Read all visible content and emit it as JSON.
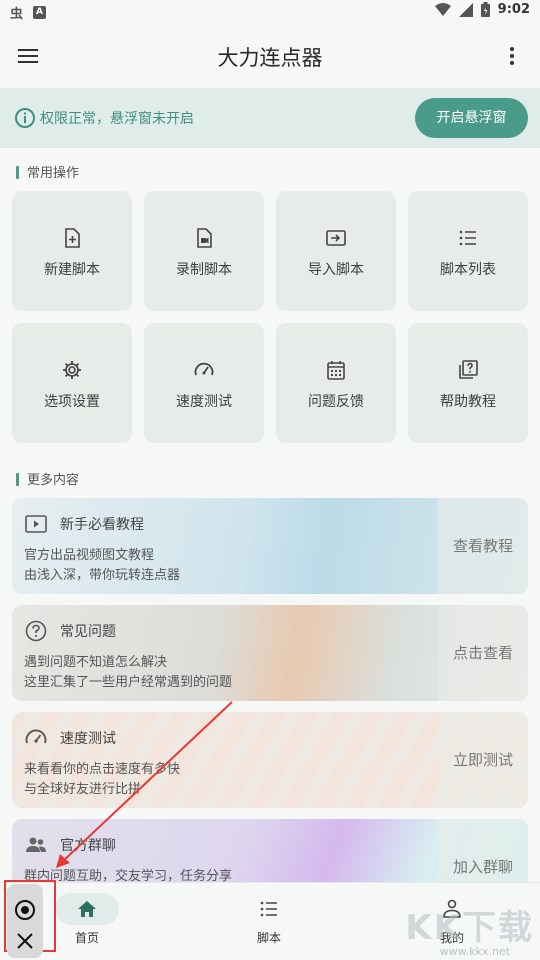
{
  "status_bar": {
    "left_glyph": "虫",
    "left_box": "A",
    "time": "9:02"
  },
  "app_bar": {
    "title": "大力连点器"
  },
  "banner": {
    "text": "权限正常，悬浮窗未开启",
    "button": "开启悬浮窗"
  },
  "common_ops": {
    "title": "常用操作",
    "tiles": [
      {
        "label": "新建脚本",
        "icon": "new-script-icon"
      },
      {
        "label": "录制脚本",
        "icon": "record-script-icon"
      },
      {
        "label": "导入脚本",
        "icon": "import-script-icon"
      },
      {
        "label": "脚本列表",
        "icon": "script-list-icon"
      },
      {
        "label": "选项设置",
        "icon": "settings-gear-icon"
      },
      {
        "label": "速度测试",
        "icon": "speedometer-icon"
      },
      {
        "label": "问题反馈",
        "icon": "calendar-feedback-icon"
      },
      {
        "label": "帮助教程",
        "icon": "help-book-icon"
      }
    ]
  },
  "more": {
    "title": "更多内容",
    "cards": [
      {
        "title": "新手必看教程",
        "line1": "官方出品视频图文教程",
        "line2": "由浅入深，带你玩转连点器",
        "action": "查看教程",
        "icon": "play-video-icon"
      },
      {
        "title": "常见问题",
        "line1": "遇到问题不知道怎么解决",
        "line2": "这里汇集了一些用户经常遇到的问题",
        "action": "点击查看",
        "icon": "question-circle-icon"
      },
      {
        "title": "速度测试",
        "line1": "来看看你的点击速度有多快",
        "line2": "与全球好友进行比拼",
        "action": "立即测试",
        "icon": "speedometer-icon"
      },
      {
        "title": "官方群聊",
        "line1": "群内问题互助，交友学习，任务分享",
        "line2": "",
        "action": "加入群聊",
        "icon": "group-people-icon"
      }
    ]
  },
  "bottom_nav": {
    "items": [
      {
        "label": "首页",
        "icon": "home-icon",
        "active": true
      },
      {
        "label": "脚本",
        "icon": "list-icon",
        "active": false
      },
      {
        "label": "我的",
        "icon": "person-icon",
        "active": false
      }
    ]
  },
  "watermark": {
    "text": "KK下载",
    "url": "www.kkx.net"
  },
  "colors": {
    "accent": "#4a9b8a",
    "banner_bg": "#dfece9",
    "annotation_red": "#e53935"
  }
}
